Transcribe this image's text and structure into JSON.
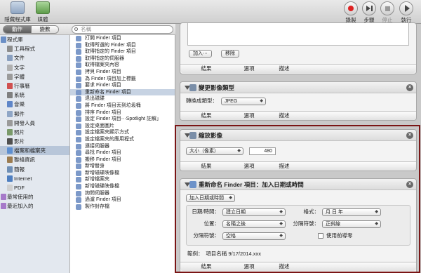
{
  "toolbar": {
    "left_buttons": [
      {
        "label": "隱藏程式庫",
        "icon": "library-icon"
      },
      {
        "label": "媒體",
        "icon": "media-icon"
      }
    ],
    "right_buttons": [
      {
        "label": "錄製",
        "icon": "record-icon"
      },
      {
        "label": "步驟",
        "icon": "step-icon"
      },
      {
        "label": "停止",
        "icon": "stop-icon"
      },
      {
        "label": "執行",
        "icon": "run-icon"
      }
    ]
  },
  "subbar": {
    "segments": [
      "動作",
      "變數"
    ],
    "search_placeholder": "名稱"
  },
  "library": {
    "items": [
      {
        "label": "程式庫",
        "level": 0,
        "icon": "library-folder-icon",
        "color": "#6b8fc6"
      },
      {
        "label": "工具程式",
        "level": 1,
        "icon": "utility-icon",
        "color": "#8d8d8d"
      },
      {
        "label": "文件",
        "level": 1,
        "icon": "document-icon",
        "color": "#8aa0c0"
      },
      {
        "label": "文字",
        "level": 1,
        "icon": "text-icon",
        "color": "#b0b0b0"
      },
      {
        "label": "字體",
        "level": 1,
        "icon": "font-icon",
        "color": "#9b9b9b"
      },
      {
        "label": "行事曆",
        "level": 1,
        "icon": "calendar-icon",
        "color": "#d05050"
      },
      {
        "label": "系統",
        "level": 1,
        "icon": "system-icon",
        "color": "#808080"
      },
      {
        "label": "音樂",
        "level": 1,
        "icon": "music-icon",
        "color": "#5f86c8"
      },
      {
        "label": "郵件",
        "level": 1,
        "icon": "mail-icon",
        "color": "#8fa6c6"
      },
      {
        "label": "開發人員",
        "level": 1,
        "icon": "developer-icon",
        "color": "#9a9a9a"
      },
      {
        "label": "照片",
        "level": 1,
        "icon": "photo-icon",
        "color": "#7a9a6a"
      },
      {
        "label": "影片",
        "level": 1,
        "icon": "movie-icon",
        "color": "#505050"
      },
      {
        "label": "檔案和檔案夾",
        "level": 1,
        "icon": "finder-icon",
        "color": "#5e8fd0",
        "selected": true
      },
      {
        "label": "聯絡資訊",
        "level": 1,
        "icon": "contacts-icon",
        "color": "#9c7c50"
      },
      {
        "label": "簡報",
        "level": 1,
        "icon": "presentation-icon",
        "color": "#6f8fb5"
      },
      {
        "label": "Internet",
        "level": 1,
        "icon": "internet-icon",
        "color": "#4f7fc0"
      },
      {
        "label": "PDF",
        "level": 1,
        "icon": "pdf-icon",
        "color": "#d0d0d0"
      },
      {
        "label": "最常使用的",
        "level": 0,
        "icon": "smart-folder-icon",
        "color": "#a679c9"
      },
      {
        "label": "最近加入的",
        "level": 0,
        "icon": "smart-folder-icon",
        "color": "#a679c9"
      }
    ]
  },
  "actions": {
    "items": [
      {
        "label": "打開 Finder 項目"
      },
      {
        "label": "取得所選的 Finder 項目"
      },
      {
        "label": "取得指定的 Finder 項目"
      },
      {
        "label": "取得指定的伺服器"
      },
      {
        "label": "取得檔案夾內容"
      },
      {
        "label": "拷貝 Finder 項目"
      },
      {
        "label": "為 Finder 項目加上標籤"
      },
      {
        "label": "要求 Finder 項目"
      },
      {
        "label": "重新命名 Finder 項目",
        "selected": true
      },
      {
        "label": "退出磁碟"
      },
      {
        "label": "將 Finder 項目丟到垃圾桶"
      },
      {
        "label": "排序 Finder 項目"
      },
      {
        "label": "設定 Finder 項目⋯Spotlight 註解」"
      },
      {
        "label": "設定桌面圖片"
      },
      {
        "label": "設定檔案夾顯示方式"
      },
      {
        "label": "設定檔案夾的應用程式"
      },
      {
        "label": "連接伺服器"
      },
      {
        "label": "尋找 Finder 項目"
      },
      {
        "label": "搬移 Finder 項目"
      },
      {
        "label": "新增替身"
      },
      {
        "label": "新增磁碟映像檔"
      },
      {
        "label": "新增檔案夾"
      },
      {
        "label": "新增磁碟映像檔"
      },
      {
        "label": "詢問伺服器"
      },
      {
        "label": "過濾 Finder 項目"
      },
      {
        "label": "製作封存檔"
      }
    ]
  },
  "workflow": {
    "top_card": {
      "add_label": "加入⋯",
      "remove_label": "移除",
      "footer": [
        "結果",
        "選項",
        "描述"
      ]
    },
    "change_type": {
      "title": "變更影像類型",
      "convert_label": "轉換成類型：",
      "convert_value": "JPEG",
      "footer": [
        "結果",
        "選項",
        "描述"
      ]
    },
    "scale": {
      "title": "縮放影像",
      "mode_value": "大小（像素）",
      "size_value": "480",
      "footer": [
        "結果",
        "選項",
        "描述"
      ]
    },
    "rename": {
      "title": "重新命名 Finder 項目：加入日期或時間",
      "mode_value": "加入日期或時間",
      "date_time_label": "日期/時間：",
      "date_time_value": "建立日期",
      "format_label": "格式：",
      "format_value": "月 日 年",
      "position_label": "位置：",
      "position_value": "名稱之後",
      "sep_label": "分隔符號：",
      "sep_value": "正斜線",
      "sep2_label": "分隔符號：",
      "sep2_value": "空格",
      "leading_zero_label": "使用前導零",
      "example": "範例：　項目名稱 9/17/2014.xxx",
      "footer": [
        "結果",
        "選項",
        "描述"
      ]
    }
  }
}
